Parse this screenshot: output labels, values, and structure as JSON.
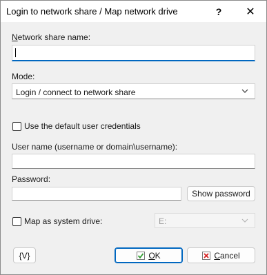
{
  "window": {
    "title": "Login to network share / Map network drive",
    "help_glyph": "?",
    "close_glyph": "✕"
  },
  "share": {
    "label_first": "N",
    "label_rest": "etwork share name:",
    "value": ""
  },
  "mode": {
    "label": "Mode:",
    "selected": "Login / connect to network share"
  },
  "default_credentials": {
    "label": "Use the default user credentials",
    "checked": false
  },
  "username": {
    "label": "User name (username or domain\\username):",
    "value": ""
  },
  "password": {
    "label": "Password:",
    "value": "",
    "show_button": "Show password"
  },
  "map_drive": {
    "label": "Map as system drive:",
    "checked": false,
    "drive_selected": "E:"
  },
  "footer": {
    "variables_button": "{V}",
    "ok_first": "O",
    "ok_rest": "K",
    "cancel_first": "C",
    "cancel_rest": "ancel",
    "ok_icon_color": "#2e9b2e",
    "cancel_icon_color": "#d42020"
  }
}
